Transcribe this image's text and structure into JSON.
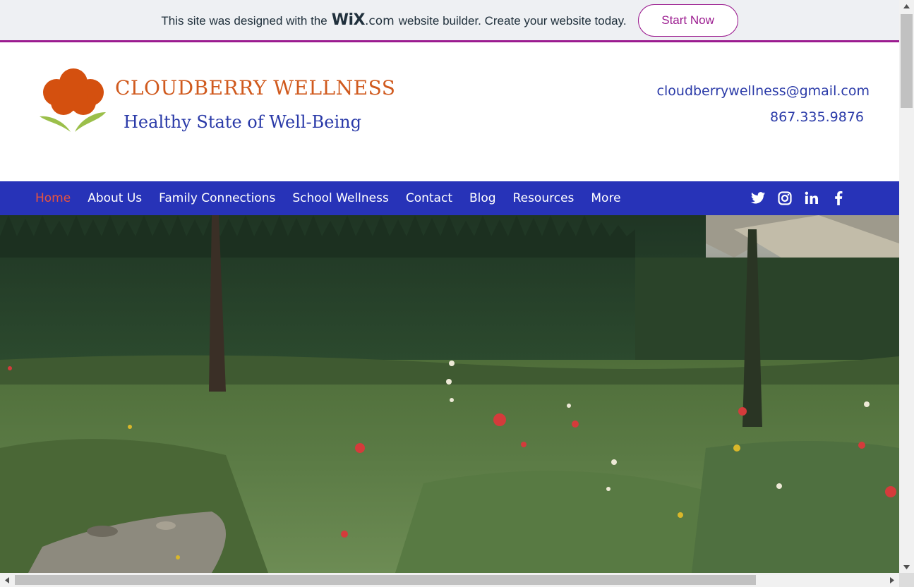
{
  "banner": {
    "text_before": "This site was designed with the",
    "logo_wix": "WiX",
    "logo_com": ".com",
    "text_after": "website builder. Create your website today.",
    "cta": "Start Now",
    "accent": "#9b1b8f"
  },
  "header": {
    "title": "CLOUDBERRY WELLNESS",
    "tagline": "Healthy State of Well-Being",
    "email": "cloudberrywellness@gmail.com",
    "phone": "867.335.9876",
    "title_color": "#d05a1e",
    "tagline_color": "#2a3aa8"
  },
  "nav": {
    "background": "#2733b8",
    "items": [
      {
        "label": "Home",
        "active": true
      },
      {
        "label": "About Us"
      },
      {
        "label": "Family Connections"
      },
      {
        "label": "School Wellness"
      },
      {
        "label": "Contact"
      },
      {
        "label": "Blog"
      },
      {
        "label": "Resources"
      },
      {
        "label": "More"
      }
    ],
    "social": [
      "twitter-icon",
      "instagram-icon",
      "linkedin-icon",
      "facebook-icon"
    ]
  },
  "hero": {
    "icon": "mountain-meadow-photo"
  }
}
